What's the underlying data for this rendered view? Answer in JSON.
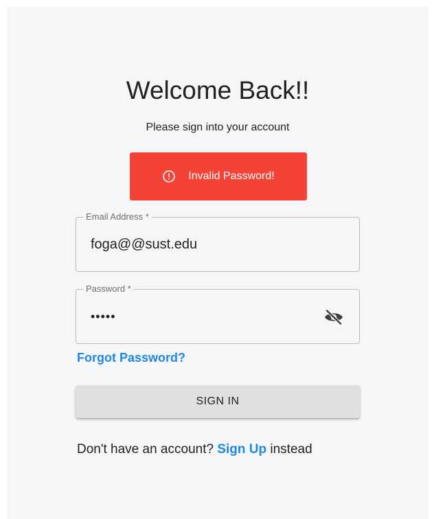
{
  "page": {
    "title": "Welcome Back!!",
    "subtitle": "Please sign into your account"
  },
  "alert": {
    "message": "Invalid Password!",
    "icon": "alert-circle-icon",
    "color": "#f44336"
  },
  "email": {
    "label": "Email Address *",
    "value": "foga@@sust.edu"
  },
  "password": {
    "label": "Password *",
    "value": "aaaaa",
    "toggle_icon": "eye-off-icon"
  },
  "forgot": {
    "label": "Forgot Password?"
  },
  "signin": {
    "label": "SIGN IN"
  },
  "signup": {
    "prefix": "Don't have an account? ",
    "link": "Sign Up",
    "suffix": " instead"
  },
  "colors": {
    "link": "#1e88e5",
    "background": "#f5f6f8"
  }
}
